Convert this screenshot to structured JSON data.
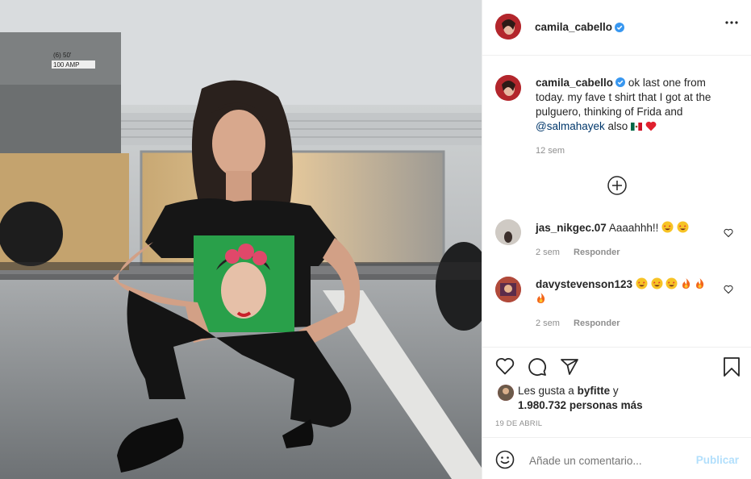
{
  "post": {
    "author": "camila_cabello",
    "caption_line1": "ok last one from",
    "caption_line2": "today. my fave t shirt that I got at the",
    "caption_line3": "pulguero, thinking of Frida and",
    "caption_mention": "@salmahayek",
    "caption_tail": "also",
    "caption_time": "12 sem",
    "date": "19 DE ABRIL"
  },
  "photo_texts": {
    "panel_label1": "(6) 50'",
    "panel_label2": "100 AMP"
  },
  "comments": [
    {
      "user": "jas_nikgec.07",
      "text": "Aaaahhh!!",
      "time": "2 sem",
      "reply": "Responder"
    },
    {
      "user": "davystevenson123",
      "time": "2 sem",
      "reply": "Responder"
    }
  ],
  "likes": {
    "line1_prefix": "Les gusta a",
    "line1_user": "byfitte",
    "line1_suffix": "y",
    "line2_count": "1.980.732",
    "line2_suffix": "personas más"
  },
  "composer": {
    "placeholder": "Añade un comentario...",
    "publish": "Publicar"
  },
  "colors": {
    "accent": "#0095f6",
    "verified": "#3897f0",
    "muted": "#8e8e8e",
    "publish_disabled": "#b2dffc"
  }
}
